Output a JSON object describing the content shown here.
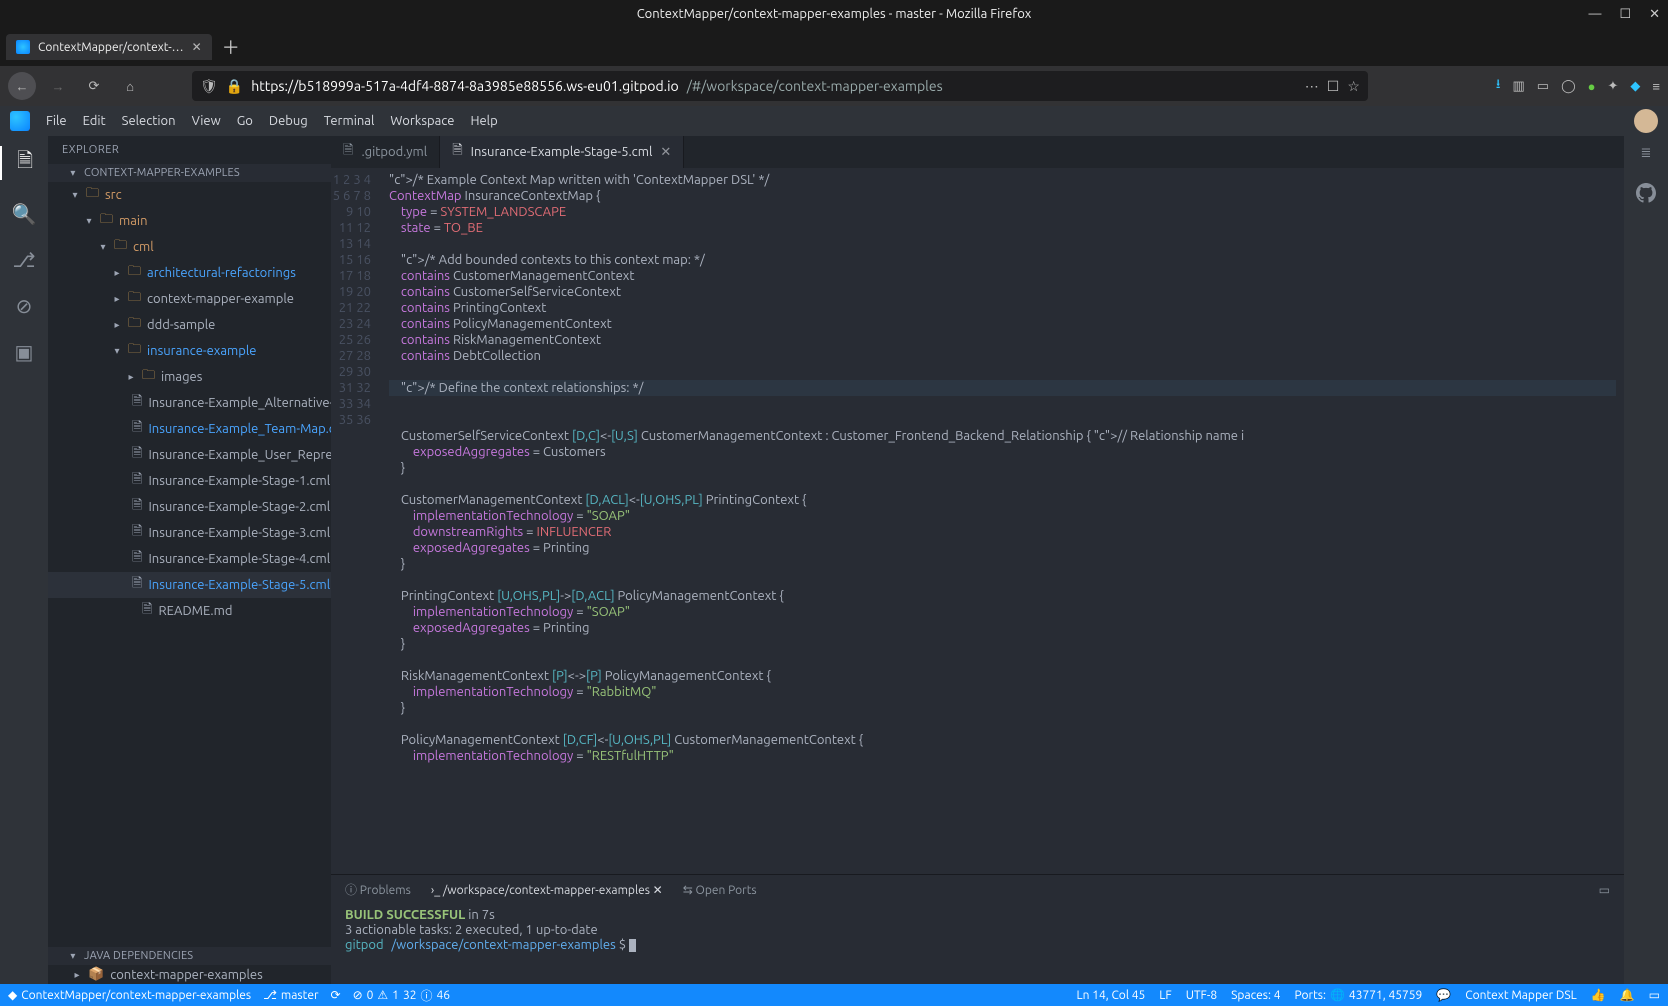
{
  "window": {
    "title": "ContextMapper/context-mapper-examples - master - Mozilla Firefox"
  },
  "browser": {
    "tab_title": "ContextMapper/context-…",
    "url_host": "https://b518999a-517a-4df4-8874-8a3985e88556.ws-eu01.gitpod.io",
    "url_path": "/#/workspace/context-mapper-examples"
  },
  "menubar": [
    "File",
    "Edit",
    "Selection",
    "View",
    "Go",
    "Debug",
    "Terminal",
    "Workspace",
    "Help"
  ],
  "explorer": {
    "title": "EXPLORER",
    "section": "CONTEXT-MAPPER-EXAMPLES",
    "tree": [
      {
        "d": 1,
        "chev": "▾",
        "icon": "folder",
        "mod": true,
        "label": "src"
      },
      {
        "d": 2,
        "chev": "▾",
        "icon": "folder",
        "mod": true,
        "label": "main"
      },
      {
        "d": 3,
        "chev": "▾",
        "icon": "folder",
        "mod": true,
        "label": "cml"
      },
      {
        "d": 4,
        "chev": "▸",
        "icon": "folder",
        "link": true,
        "label": "architectural-refactorings"
      },
      {
        "d": 4,
        "chev": "▸",
        "icon": "folder",
        "label": "context-mapper-example"
      },
      {
        "d": 4,
        "chev": "▸",
        "icon": "folder",
        "label": "ddd-sample"
      },
      {
        "d": 4,
        "chev": "▾",
        "icon": "folder",
        "link": true,
        "mod": true,
        "label": "insurance-example"
      },
      {
        "d": 5,
        "chev": "▸",
        "icon": "folder",
        "label": "images"
      },
      {
        "d": 5,
        "icon": "file",
        "label": "Insurance-Example_Alternative-Relationship..."
      },
      {
        "d": 5,
        "icon": "file",
        "link": true,
        "label": "Insurance-Example_Team-Map.cml"
      },
      {
        "d": 5,
        "icon": "file",
        "label": "Insurance-Example_User_Representations.scl"
      },
      {
        "d": 5,
        "icon": "file",
        "label": "Insurance-Example-Stage-1.cml"
      },
      {
        "d": 5,
        "icon": "file",
        "label": "Insurance-Example-Stage-2.cml"
      },
      {
        "d": 5,
        "icon": "file",
        "label": "Insurance-Example-Stage-3.cml"
      },
      {
        "d": 5,
        "icon": "file",
        "label": "Insurance-Example-Stage-4.cml"
      },
      {
        "d": 5,
        "icon": "file",
        "link": true,
        "sel": true,
        "label": "Insurance-Example-Stage-5.cml"
      },
      {
        "d": 5,
        "icon": "file",
        "label": "README.md"
      }
    ],
    "deps_section": "JAVA DEPENDENCIES",
    "deps_item": "context-mapper-examples"
  },
  "editor": {
    "tabs": [
      {
        "label": ".gitpod.yml",
        "active": false
      },
      {
        "label": "Insurance-Example-Stage-5.cml",
        "active": true
      }
    ],
    "lines": [
      "/* Example Context Map written with 'ContextMapper DSL' */",
      "ContextMap InsuranceContextMap {",
      "    type = SYSTEM_LANDSCAPE",
      "    state = TO_BE",
      "",
      "    /* Add bounded contexts to this context map: */",
      "    contains CustomerManagementContext",
      "    contains CustomerSelfServiceContext",
      "    contains PrintingContext",
      "    contains PolicyManagementContext",
      "    contains RiskManagementContext",
      "    contains DebtCollection",
      "",
      "    /* Define the context relationships: */",
      "",
      "    CustomerSelfServiceContext [D,C]<-[U,S] CustomerManagementContext : Customer_Frontend_Backend_Relationship { // Relationship name i",
      "        exposedAggregates = Customers",
      "    }",
      "",
      "    CustomerManagementContext [D,ACL]<-[U,OHS,PL] PrintingContext {",
      "        implementationTechnology = \"SOAP\"",
      "        downstreamRights = INFLUENCER",
      "        exposedAggregates = Printing",
      "    }",
      "",
      "    PrintingContext [U,OHS,PL]->[D,ACL] PolicyManagementContext {",
      "        implementationTechnology = \"SOAP\"",
      "        exposedAggregates = Printing",
      "    }",
      "",
      "    RiskManagementContext [P]<->[P] PolicyManagementContext {",
      "        implementationTechnology = \"RabbitMQ\"",
      "    }",
      "",
      "    PolicyManagementContext [D,CF]<-[U,OHS,PL] CustomerManagementContext {",
      "        implementationTechnology = \"RESTfulHTTP\""
    ],
    "hl_line": 14
  },
  "panel": {
    "tabs": {
      "problems": "Problems",
      "terminal": "/workspace/context-mapper-examples",
      "openports": "Open Ports"
    },
    "term": {
      "build": "BUILD SUCCESSFUL",
      "build_tail": " in 7s",
      "tasks": "3 actionable tasks: 2 executed, 1 up-to-date",
      "user": "gitpod",
      "cwd": "/workspace/context-mapper-examples",
      "prompt": " $ "
    }
  },
  "status": {
    "repo": "ContextMapper/context-mapper-examples",
    "branch": "master",
    "sync": "⟳",
    "err": "0",
    "warn": "1",
    "info": "32",
    "hint": "46",
    "pos": "Ln 14, Col 45",
    "eol": "LF",
    "enc": "UTF-8",
    "spaces": "Spaces: 4",
    "ports": "Ports: ",
    "port_list": "43771, 45759",
    "lang": "Context Mapper DSL",
    "feedback": "☺"
  }
}
